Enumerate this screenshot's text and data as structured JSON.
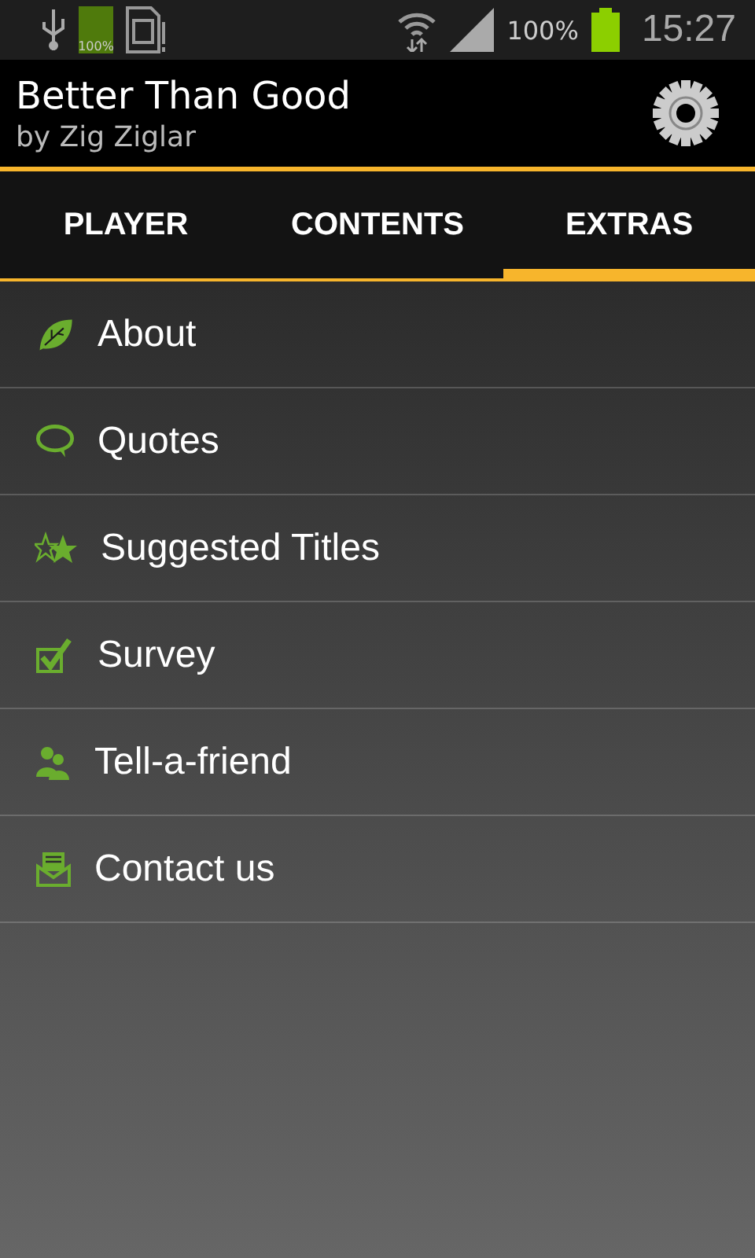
{
  "status_bar": {
    "battery_icon_label": "100%",
    "battery_percent": "100%",
    "time": "15:27"
  },
  "header": {
    "title": "Better Than Good",
    "subtitle": "by Zig Ziglar"
  },
  "tabs": [
    {
      "label": "PLAYER",
      "selected": false
    },
    {
      "label": "CONTENTS",
      "selected": false
    },
    {
      "label": "EXTRAS",
      "selected": true
    }
  ],
  "menu_items": [
    {
      "label": "About"
    },
    {
      "label": "Quotes"
    },
    {
      "label": "Suggested Titles"
    },
    {
      "label": "Survey"
    },
    {
      "label": "Tell-a-friend"
    },
    {
      "label": "Contact us"
    }
  ]
}
